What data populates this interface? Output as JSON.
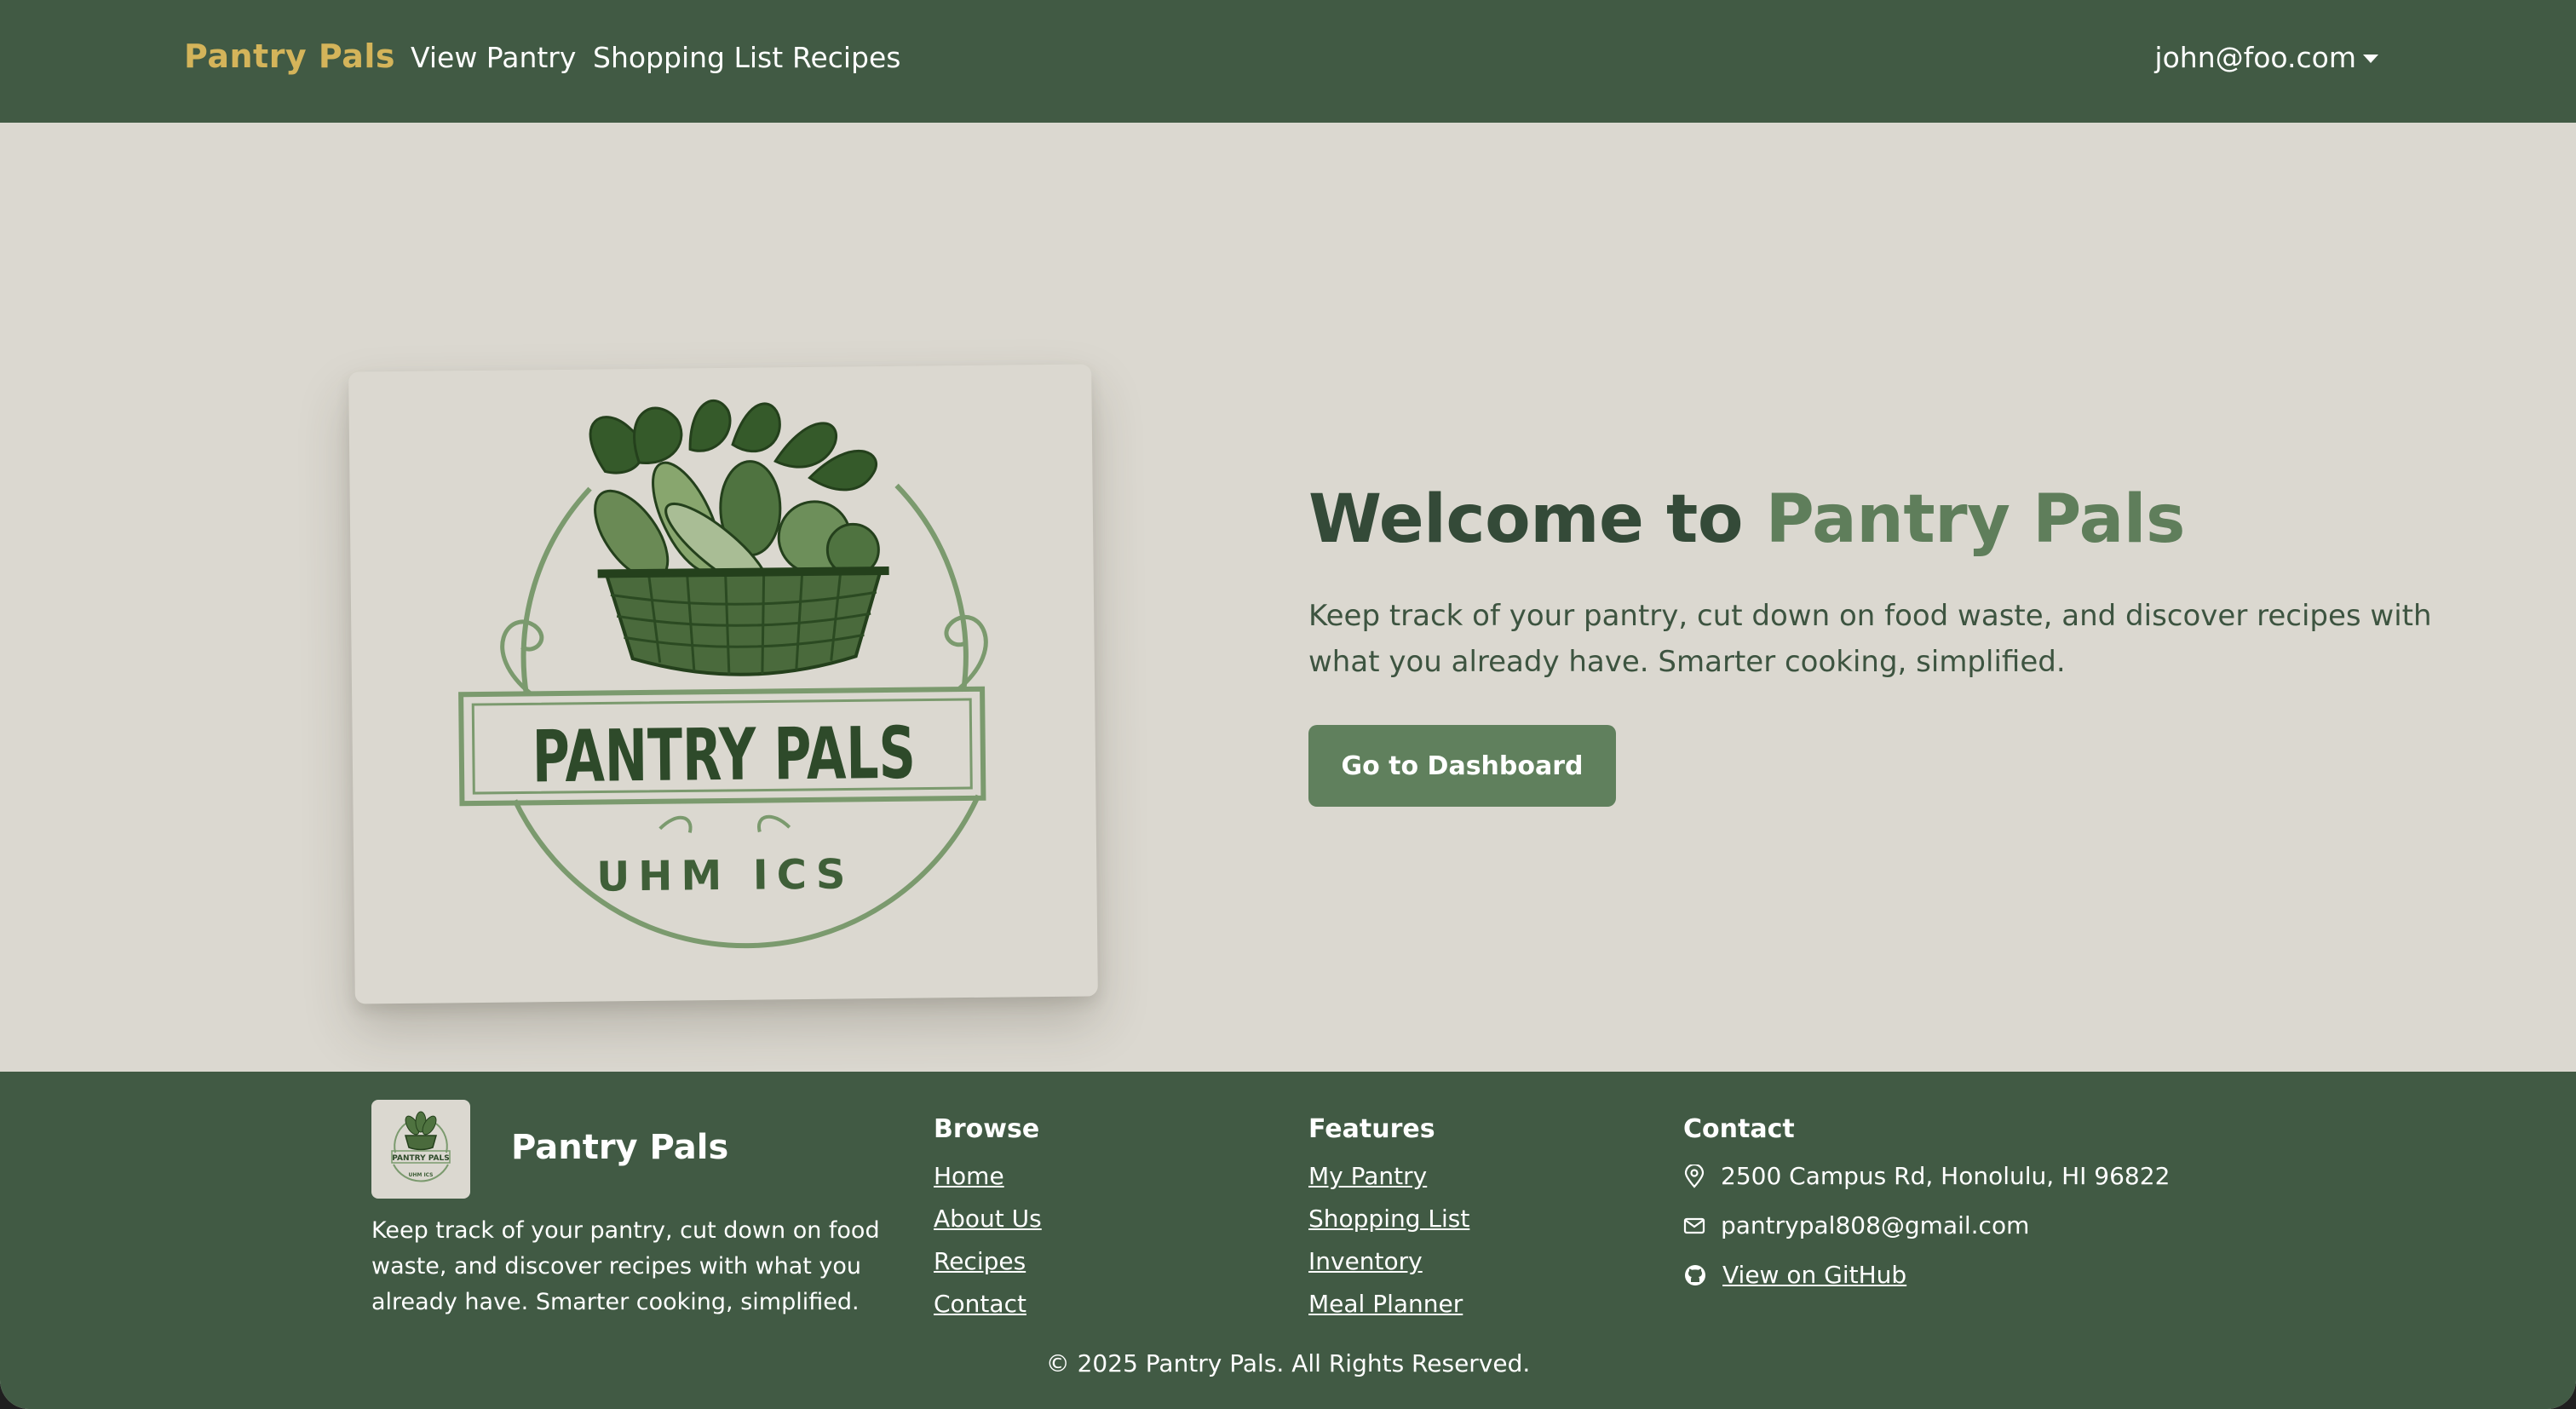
{
  "navbar": {
    "brand": "Pantry Pals",
    "links": [
      "View Pantry",
      "Shopping List",
      "Recipes"
    ],
    "user": "john@foo.com"
  },
  "hero": {
    "logo": {
      "title": "PANTRY PALS",
      "subtitle": "UHM ICS"
    },
    "title_prefix": "Welcome to ",
    "title_accent": "Pantry Pals",
    "subtitle": "Keep track of your pantry, cut down on food waste, and discover recipes with what you already have. Smarter cooking, simplified.",
    "cta_label": "Go to Dashboard"
  },
  "footer": {
    "brand": "Pantry Pals",
    "description": "Keep track of your pantry, cut down on food waste, and discover recipes with what you already have. Smarter cooking, simplified.",
    "browse": {
      "title": "Browse",
      "links": [
        "Home",
        "About Us",
        "Recipes",
        "Contact"
      ]
    },
    "features": {
      "title": "Features",
      "links": [
        "My Pantry",
        "Shopping List",
        "Inventory",
        "Meal Planner"
      ]
    },
    "contact": {
      "title": "Contact",
      "address": "2500 Campus Rd, Honolulu, HI 96822",
      "email": "pantrypal808@gmail.com",
      "github": "View on GitHub"
    },
    "copyright": "© 2025 Pantry Pals. All Rights Reserved."
  },
  "colors": {
    "nav_bg": "#415a44",
    "brand_gold": "#d4b45a",
    "page_bg": "#dbd8d0",
    "accent_green": "#5f7e5b",
    "button_green": "#60805d"
  }
}
